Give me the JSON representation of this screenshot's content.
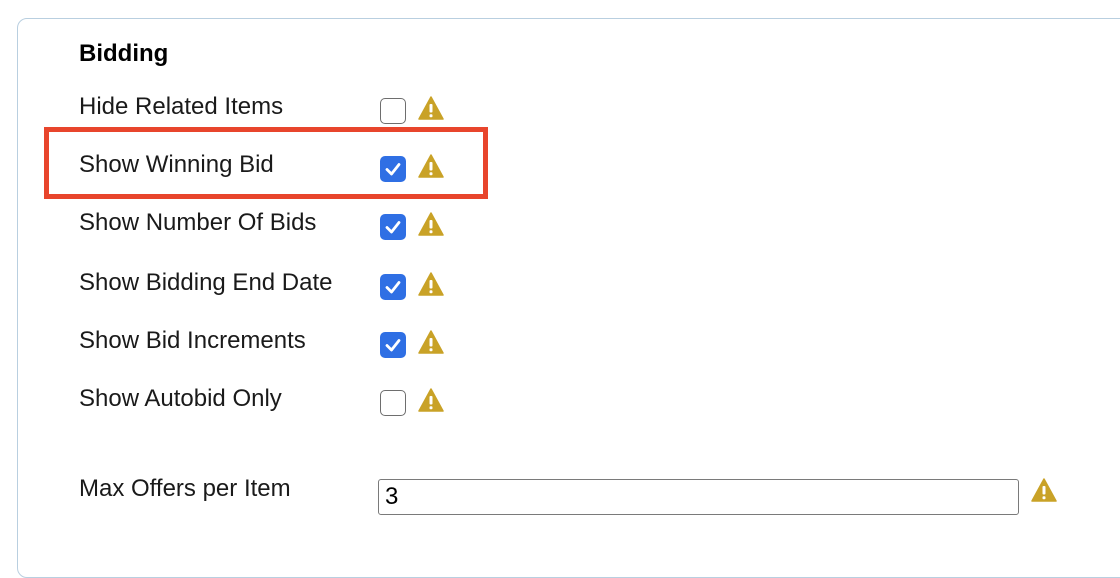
{
  "section": {
    "title": "Bidding"
  },
  "options": [
    {
      "label": "Hide Related Items",
      "checked": false
    },
    {
      "label": "Show Winning Bid",
      "checked": true
    },
    {
      "label": "Show Number Of Bids",
      "checked": true
    },
    {
      "label": "Show Bidding End Date",
      "checked": true
    },
    {
      "label": "Show Bid Increments",
      "checked": true
    },
    {
      "label": "Show Autobid Only",
      "checked": false
    }
  ],
  "max_offers": {
    "label": "Max Offers per Item",
    "value": "3"
  },
  "colors": {
    "checkbox_checked": "#2f6fe4",
    "warning_icon": "#c9a227",
    "highlight_border": "#e8452c",
    "panel_border": "#b9cfe0"
  },
  "icons": {
    "warning": "warning-triangle-icon",
    "check": "checkmark-icon"
  }
}
